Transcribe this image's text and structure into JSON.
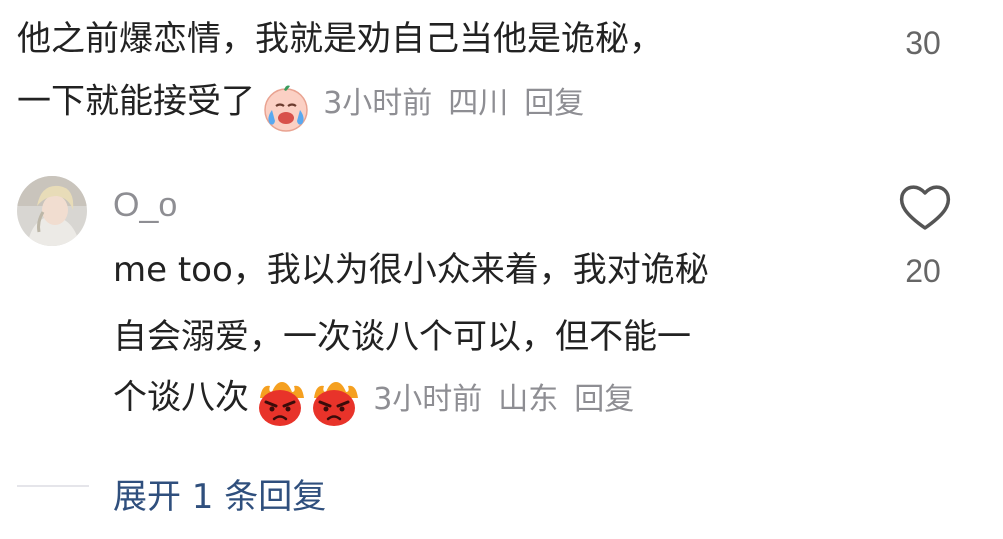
{
  "comment1": {
    "line1": "他之前爆恋情，我就是劝自己当他是诡秘，",
    "line2": "一下就能接受了",
    "time": "3小时前",
    "location": "四川",
    "reply_label": "回复",
    "like_count": "30",
    "emoji": "crying-face-emoji"
  },
  "comment2": {
    "username": "O_o",
    "line1": "me too，我以为很小众来着，我对诡秘",
    "line2": "自会溺爱，一次谈八个可以，但不能一",
    "line3": "个谈八次",
    "time": "3小时前",
    "location": "山东",
    "reply_label": "回复",
    "like_count": "20",
    "emoji": "angry-face-emoji"
  },
  "expand_replies": "展开 1 条回复",
  "colors": {
    "meta_gray": "#8e8e93",
    "link_blue": "#2f4f7d",
    "angry_red": "#e8332a",
    "crying_pink": "#f7b7a8"
  }
}
